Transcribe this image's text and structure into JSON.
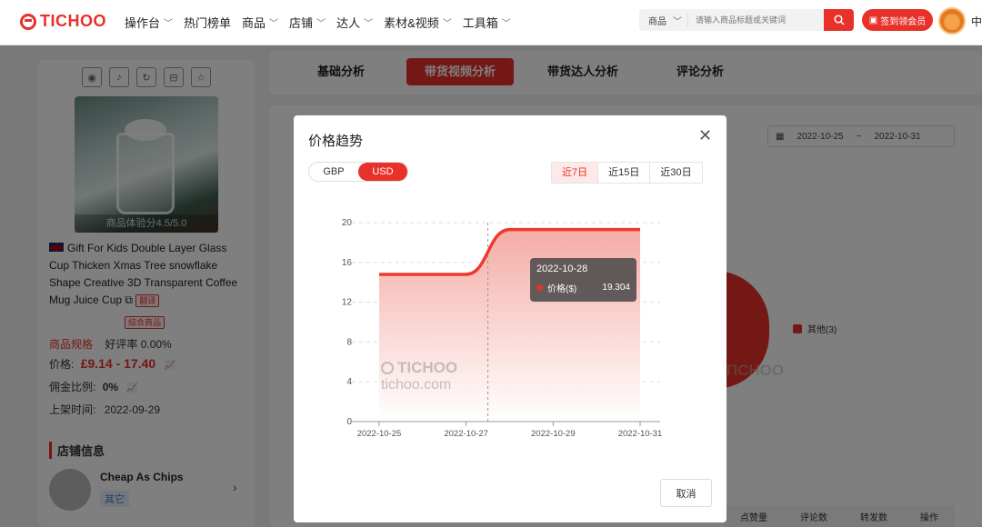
{
  "header": {
    "logo": "TICHOO",
    "nav": [
      {
        "label": "操作台",
        "has_menu": true
      },
      {
        "label": "热门榜单",
        "has_menu": false
      },
      {
        "label": "商品",
        "has_menu": true
      },
      {
        "label": "店铺",
        "has_menu": true
      },
      {
        "label": "达人",
        "has_menu": true
      },
      {
        "label": "素材&视频",
        "has_menu": true
      },
      {
        "label": "工具箱",
        "has_menu": true
      }
    ],
    "search_category": "商品",
    "search_placeholder": "请输入商品标题或关键词",
    "vip_label": "签到领会员",
    "lang": "中"
  },
  "product": {
    "rating": "商品体验分4.5/5.0",
    "title": "Gift For Kids Double Layer Glass Cup Thicken Xmas Tree snowflake Shape Creative 3D Transparent Coffee Mug Juice Cup",
    "translate_tag": "翻译",
    "category_tag": "综合商品",
    "spec_label": "商品规格",
    "rating_label": "好评率 0.00%",
    "price_label": "价格:",
    "price_value": "£9.14 - 17.40",
    "commission_label": "佣金比例:",
    "commission_value": "0%",
    "listed_label": "上架时间:",
    "listed_value": "2022-09-29"
  },
  "store": {
    "heading": "店铺信息",
    "name": "Cheap As Chips",
    "tag": "其它"
  },
  "tabs": [
    {
      "label": "基础分析",
      "active": false
    },
    {
      "label": "带货视频分析",
      "active": true
    },
    {
      "label": "带货达人分析",
      "active": false
    },
    {
      "label": "评论分析",
      "active": false
    }
  ],
  "main": {
    "date_start": "2022-10-25",
    "date_sep": "~",
    "date_end": "2022-10-31",
    "legend_other": "其他(3)",
    "table_headers": [
      "点赞量",
      "评论数",
      "转发数",
      "操作"
    ]
  },
  "modal": {
    "title": "价格趋势",
    "currencies": [
      {
        "label": "GBP",
        "active": false
      },
      {
        "label": "USD",
        "active": true
      }
    ],
    "ranges": [
      {
        "label": "近7日",
        "active": true
      },
      {
        "label": "近15日",
        "active": false
      },
      {
        "label": "近30日",
        "active": false
      }
    ],
    "tooltip": {
      "date": "2022-10-28",
      "series": "价格($)",
      "value": "19.304"
    },
    "watermark": {
      "brand": "TICHOO",
      "site": "tichoo.com"
    },
    "cancel_label": "取消"
  },
  "chart_data": {
    "type": "area",
    "x": [
      "2022-10-25",
      "2022-10-26",
      "2022-10-27",
      "2022-10-28",
      "2022-10-29",
      "2022-10-30",
      "2022-10-31"
    ],
    "xticks": [
      "2022-10-25",
      "2022-10-27",
      "2022-10-29",
      "2022-10-31"
    ],
    "series": [
      {
        "name": "价格($)",
        "values": [
          14.8,
          14.8,
          14.8,
          19.304,
          19.304,
          19.304,
          19.304
        ]
      }
    ],
    "yticks": [
      0,
      4,
      8,
      12,
      16,
      20
    ],
    "ylim": [
      0,
      20
    ],
    "grid": true,
    "colors": {
      "line": "#ee3a2c",
      "fill_top": "#f4a39c",
      "fill_bottom": "#ffffff"
    },
    "highlight_x": "2022-10-28"
  }
}
